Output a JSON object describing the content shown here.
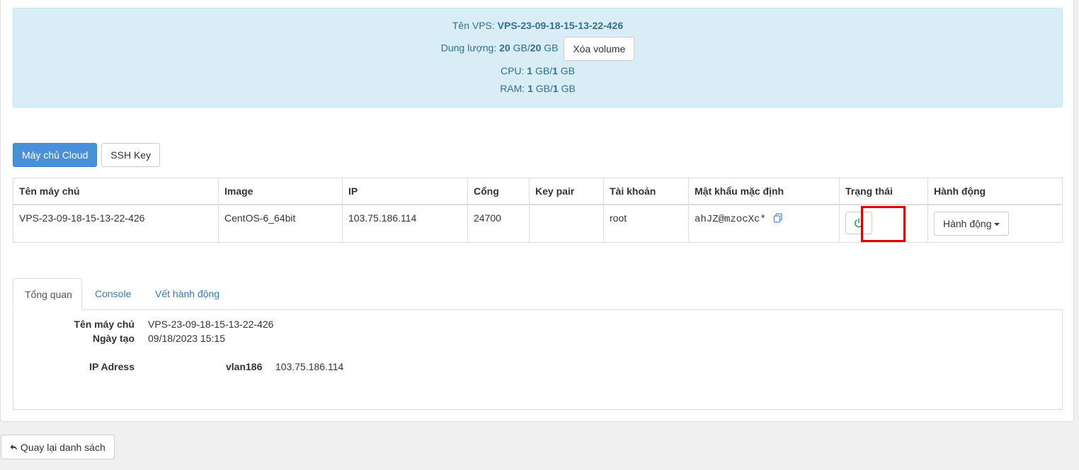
{
  "info": {
    "name_label": "Tên VPS:",
    "name_value": "VPS-23-09-18-15-13-22-426",
    "disk_label": "Dung lượng:",
    "disk_used": "20",
    "disk_unit1": "GB/",
    "disk_total": "20",
    "disk_unit2": "GB",
    "delete_volume": "Xóa volume",
    "cpu_label": "CPU:",
    "cpu_used": "1",
    "cpu_unit1": "GB/",
    "cpu_total": "1",
    "cpu_unit2": "GB",
    "ram_label": "RAM:",
    "ram_used": "1",
    "ram_unit1": "GB/",
    "ram_total": "1",
    "ram_unit2": "GB"
  },
  "top_tabs": {
    "cloud": "Máy chủ Cloud",
    "ssh": "SSH Key"
  },
  "table": {
    "headers": [
      "Tên máy chủ",
      "Image",
      "IP",
      "Cổng",
      "Key pair",
      "Tài khoản",
      "Mật khẩu mặc định",
      "Trạng thái",
      "Hành động"
    ],
    "row": {
      "name": "VPS-23-09-18-15-13-22-426",
      "image": "CentOS-6_64bit",
      "ip": "103.75.186.114",
      "port": "24700",
      "keypair": "",
      "account": "root",
      "password": "ahJZ@mzocXc*",
      "action_label": "Hành động"
    }
  },
  "icons": {
    "copy": "copy-icon",
    "power": "power-icon",
    "back": "reply-arrow-icon"
  },
  "colors": {
    "power_on": "#27a844",
    "highlight": "#e00000",
    "primary": "#4a90d9"
  },
  "tabs": {
    "overview": "Tổng quan",
    "console": "Console",
    "log": "Vết hành động"
  },
  "overview": {
    "name_label": "Tên máy chủ",
    "name_value": "VPS-23-09-18-15-13-22-426",
    "created_label": "Ngày tạo",
    "created_value": "09/18/2023 15:15",
    "ip_label": "IP Adress",
    "vlan": "vlan186",
    "ip_value": "103.75.186.114"
  },
  "back_button": "Quay lại danh sách"
}
